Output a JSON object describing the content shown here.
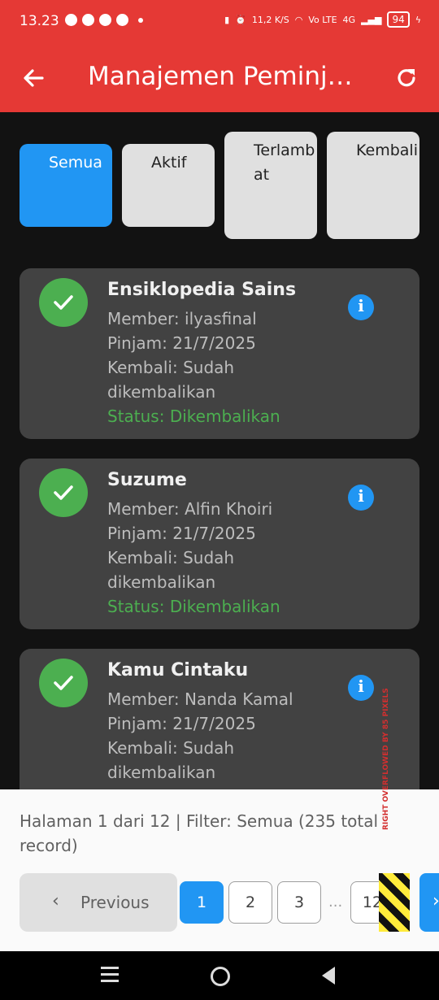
{
  "status_bar": {
    "time": "13.23",
    "network_speed": "11,2 K/S",
    "network_type": "Vo LTE",
    "signal_gen": "4G",
    "battery": "94",
    "icons": [
      "whatsapp-icon",
      "chat-icon",
      "settings-icon",
      "instagram-icon",
      "vibrate-icon",
      "alarm-icon",
      "wifi-icon",
      "signal-icon",
      "charging-icon"
    ]
  },
  "appbar": {
    "title": "Manajemen Peminjaman",
    "back_icon": "arrow-left-icon",
    "refresh_icon": "refresh-icon"
  },
  "filters": [
    {
      "label": "Semua",
      "active": true
    },
    {
      "label": "Aktif",
      "active": false
    },
    {
      "label": "Terlambat",
      "active": false
    },
    {
      "label": "Kembali",
      "active": false
    }
  ],
  "loans": [
    {
      "title": "Ensiklopedia Sains",
      "member": "Member: ilyasfinal",
      "borrow": "Pinjam: 21/7/2025",
      "return_label": "Kembali: Sudah",
      "return_value": "dikembalikan",
      "status": "Status: Dikembalikan"
    },
    {
      "title": "Suzume",
      "member": "Member: Alfin Khoiri",
      "borrow": "Pinjam: 21/7/2025",
      "return_label": "Kembali: Sudah",
      "return_value": "dikembalikan",
      "status": "Status: Dikembalikan"
    },
    {
      "title": "Kamu Cintaku",
      "member": "Member: Nanda Kamal",
      "borrow": "Pinjam: 21/7/2025",
      "return_label": "Kembali: Sudah",
      "return_value": "dikembalikan",
      "status": ""
    }
  ],
  "pagination": {
    "info": "Halaman 1 dari 12 | Filter: Semua (235 total record)",
    "previous_label": "Previous",
    "pages": [
      "1",
      "2",
      "3",
      "12"
    ],
    "current_page": "1",
    "ellipsis": "...",
    "next_symbol": "›",
    "overflow_warning": "RIGHT OVERFLOWED BY 85 PIXELS"
  },
  "colors": {
    "primary_red": "#E53935",
    "accent_blue": "#2196F3",
    "success_green": "#4CAF50",
    "card_bg": "#424242",
    "page_bg": "#121212"
  }
}
